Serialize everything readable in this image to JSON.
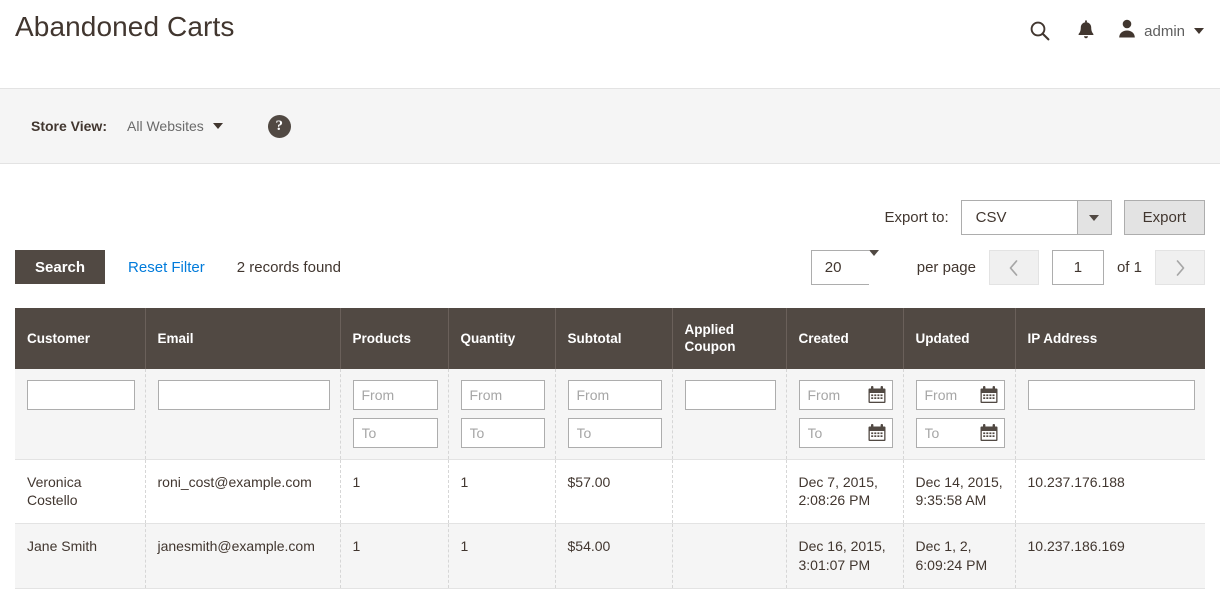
{
  "header": {
    "title": "Abandoned Carts",
    "search_icon": "search-icon",
    "notifications_icon": "bell-icon",
    "avatar_icon": "user-avatar-icon",
    "admin_label": "admin"
  },
  "store_view": {
    "label": "Store View:",
    "value": "All Websites",
    "help_icon": "question-mark-icon"
  },
  "export": {
    "label": "Export to:",
    "format": "CSV",
    "button": "Export"
  },
  "controls": {
    "search_button": "Search",
    "reset_filter": "Reset Filter",
    "records_found": "2 records found"
  },
  "pager": {
    "per_page_value": "20",
    "per_page_label": "per page",
    "prev_icon": "chevron-left-icon",
    "next_icon": "chevron-right-icon",
    "current_page": "1",
    "of_label": "of 1"
  },
  "grid": {
    "columns": [
      {
        "label": "Customer",
        "key": "customer"
      },
      {
        "label": "Email",
        "key": "email"
      },
      {
        "label": "Products",
        "key": "products"
      },
      {
        "label": "Quantity",
        "key": "quantity"
      },
      {
        "label": "Subtotal",
        "key": "subtotal"
      },
      {
        "label": "Applied Coupon",
        "key": "applied_coupon"
      },
      {
        "label": "Created",
        "key": "created"
      },
      {
        "label": "Updated",
        "key": "updated"
      },
      {
        "label": "IP Address",
        "key": "ip_address"
      }
    ],
    "filters": {
      "customer": {
        "type": "text",
        "value": "",
        "placeholder": ""
      },
      "email": {
        "type": "text",
        "value": "",
        "placeholder": ""
      },
      "products": {
        "type": "range",
        "from_placeholder": "From",
        "to_placeholder": "To",
        "from_value": "",
        "to_value": ""
      },
      "quantity": {
        "type": "range",
        "from_placeholder": "From",
        "to_placeholder": "To",
        "from_value": "",
        "to_value": ""
      },
      "subtotal": {
        "type": "range",
        "from_placeholder": "From",
        "to_placeholder": "To",
        "from_value": "",
        "to_value": ""
      },
      "applied_coupon": {
        "type": "text",
        "value": "",
        "placeholder": ""
      },
      "created": {
        "type": "date-range",
        "from_placeholder": "From",
        "to_placeholder": "To",
        "from_value": "",
        "to_value": "",
        "icon": "calendar-icon"
      },
      "updated": {
        "type": "date-range",
        "from_placeholder": "From",
        "to_placeholder": "To",
        "from_value": "",
        "to_value": "",
        "icon": "calendar-icon"
      },
      "ip_address": {
        "type": "text",
        "value": "",
        "placeholder": ""
      }
    },
    "rows": [
      {
        "customer": "Veronica Costello",
        "email": "roni_cost@example.com",
        "products": "1",
        "quantity": "1",
        "subtotal": "$57.00",
        "applied_coupon": "",
        "created": "Dec 7, 2015,\n2:08:26 PM",
        "updated": "Dec 14, 2015,\n9:35:58 AM",
        "ip_address": "10.237.176.188"
      },
      {
        "customer": "Jane Smith",
        "email": "janesmith@example.com",
        "products": "1",
        "quantity": "1",
        "subtotal": "$54.00",
        "applied_coupon": "",
        "created": "Dec 16, 2015,\n3:01:07 PM",
        "updated": "Dec 1, 2,\n6:09:24 PM",
        "ip_address": "10.237.186.169"
      }
    ]
  },
  "colors": {
    "accent_dark": "#514943",
    "link_blue": "#007bdb",
    "bar_bg": "#f5f5f5",
    "text": "#41362f"
  }
}
